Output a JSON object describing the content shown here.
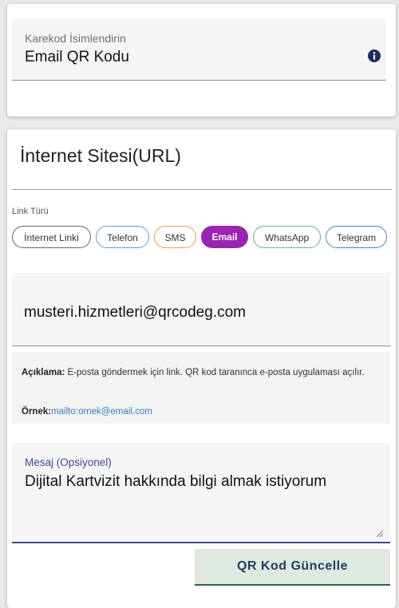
{
  "qr_name": {
    "label": "Karekod İsimlendirin",
    "value": "Email QR Kodu",
    "icon": "info-icon"
  },
  "url_section": {
    "title": "İnternet Sitesi(URL)"
  },
  "link_type": {
    "label": "Link Türü",
    "selected": "Email",
    "chips": [
      {
        "label": "İnternet Linki",
        "color": "#666666"
      },
      {
        "label": "Telefon",
        "color": "#5aa0d8"
      },
      {
        "label": "SMS",
        "color": "#f0a23a"
      },
      {
        "label": "Email",
        "color": "#9b24b2"
      },
      {
        "label": "WhatsApp",
        "color": "#4bc77b"
      },
      {
        "label": "Telegram",
        "color": "#3d88c7"
      }
    ]
  },
  "email_field": {
    "value": "musteri.hizmetleri@qrcodeg.com"
  },
  "description": {
    "label": "Açıklama:",
    "text": " E-posta göndermek için link. QR kod taranınca e-posta uygulaması açılır.",
    "example_label": "Örnek:",
    "example_value": "mailto:ornek@email.com"
  },
  "message_field": {
    "label": "Mesaj (Opsiyonel)",
    "value": "Dijital Kartvizit hakkında bilgi almak istiyorum"
  },
  "update_button": {
    "label": "QR Kod Güncelle"
  },
  "colors": {
    "accent": "#9b24b2",
    "button_text": "#253a69",
    "message_underline": "#3b4aa0",
    "link": "#2f7fd0"
  }
}
